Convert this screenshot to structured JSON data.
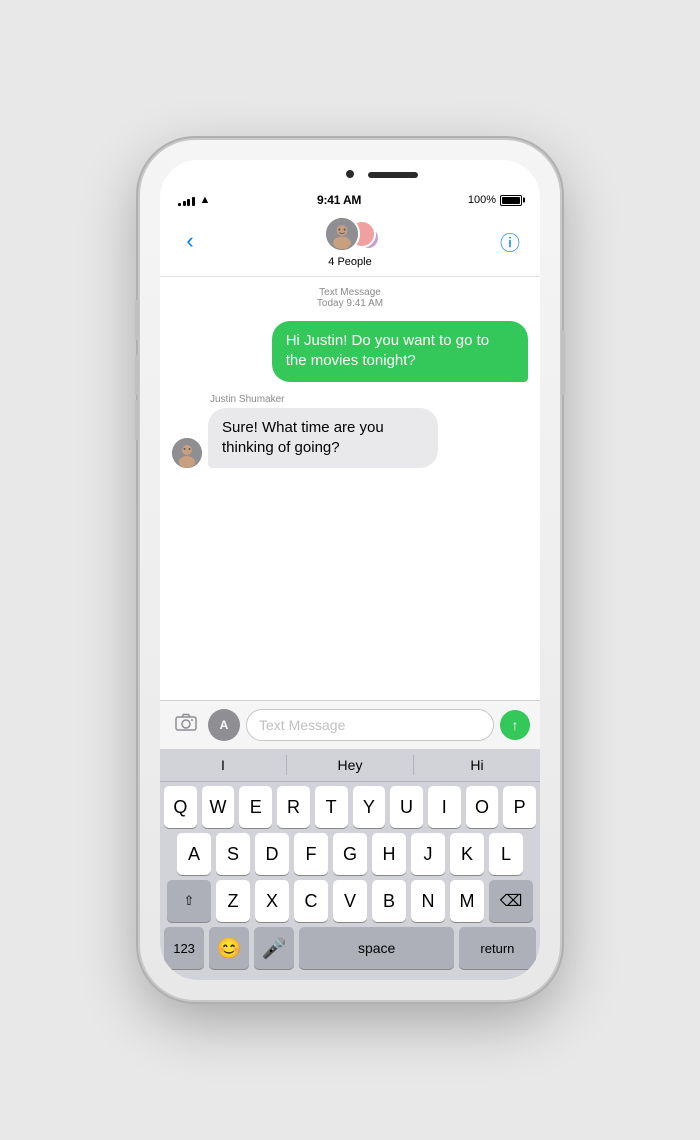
{
  "phone": {
    "statusBar": {
      "time": "9:41 AM",
      "battery": "100%",
      "signalBars": [
        3,
        5,
        7,
        9,
        11
      ],
      "wifi": "wifi"
    },
    "nav": {
      "backLabel": "‹",
      "groupName": "4 People",
      "infoIcon": "ⓘ"
    },
    "messages": [
      {
        "type": "timestamp",
        "label": "Text Message",
        "subLabel": "Today 9:41 AM"
      },
      {
        "type": "sent",
        "text": "Hi Justin! Do you want to go to the movies tonight?"
      },
      {
        "type": "received",
        "sender": "Justin Shumaker",
        "text": "Sure! What time are you thinking of going?"
      }
    ],
    "inputArea": {
      "placeholder": "Text Message",
      "cameraIcon": "📷",
      "appstoreLabel": "A",
      "sendIcon": "↑"
    },
    "predictive": {
      "items": [
        "I",
        "Hey",
        "Hi"
      ]
    },
    "keyboard": {
      "rows": [
        [
          "Q",
          "W",
          "E",
          "R",
          "T",
          "Y",
          "U",
          "I",
          "O",
          "P"
        ],
        [
          "A",
          "S",
          "D",
          "F",
          "G",
          "H",
          "J",
          "K",
          "L"
        ],
        [
          "⇧",
          "Z",
          "X",
          "C",
          "V",
          "B",
          "N",
          "M",
          "⌫"
        ],
        [
          "123",
          "😊",
          "🎤",
          "space",
          "return"
        ]
      ]
    }
  }
}
